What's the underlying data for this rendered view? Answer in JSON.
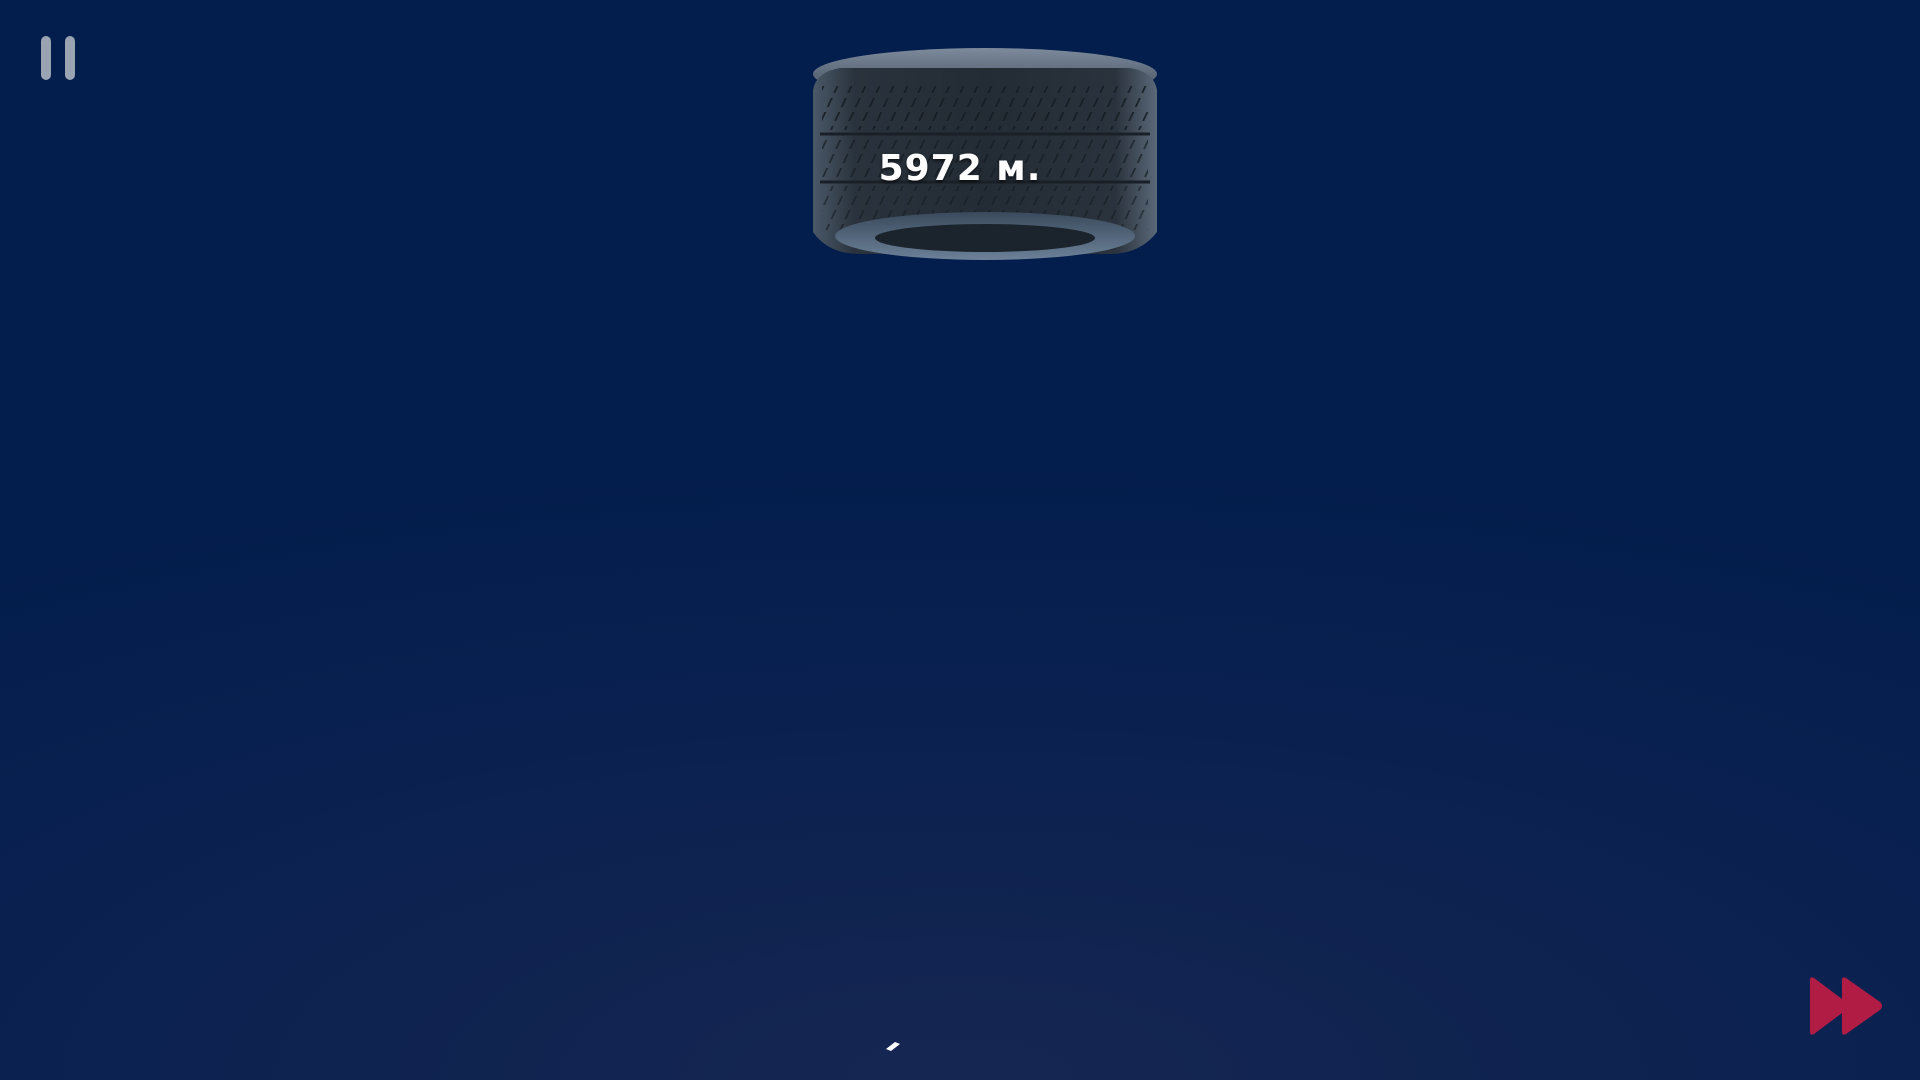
{
  "hud": {
    "distance_text": "5972 м."
  },
  "controls": {
    "pause_icon": "pause-icon",
    "fast_forward_icon": "fast-forward-icon"
  },
  "colors": {
    "sky_top": "#031d4c",
    "sky_bottom": "#162652",
    "pause": "#9aa3b2",
    "fast_forward": "#b11c44",
    "tire": "#2b3540"
  }
}
